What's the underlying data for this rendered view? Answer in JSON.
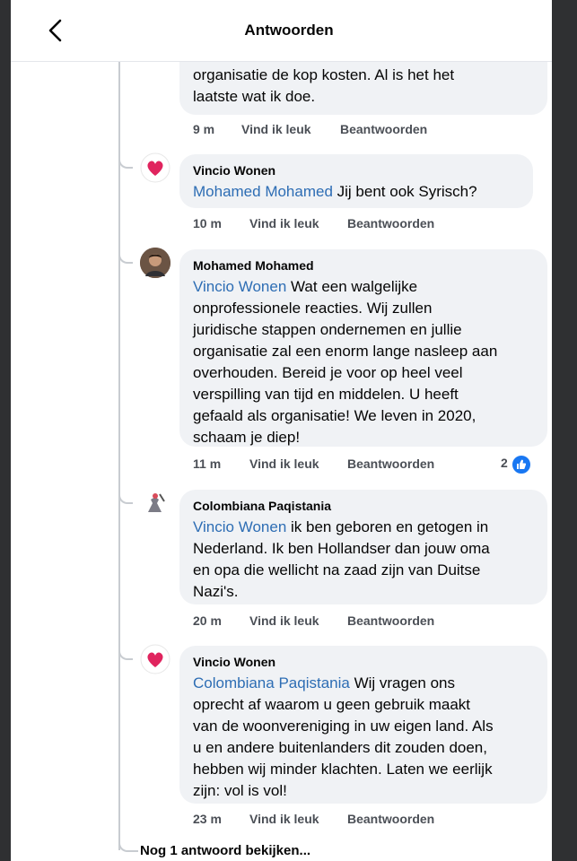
{
  "header": {
    "title": "Antwoorden",
    "back_icon": "chevron-left-icon"
  },
  "comments": [
    {
      "author": "",
      "text": "organisatie de kop kosten. Al is het het laatste wat ik doe.",
      "line1": "organisatie de kop kosten. Al is het het",
      "line2": "laatste wat ik doe.",
      "time": "9 m",
      "like": "Vind ik leuk",
      "reply": "Beantwoorden"
    },
    {
      "author": "Vincio Wonen",
      "mention": "Mohamed Mohamed",
      "text": "Jij bent ook Syrisch?",
      "time": "10 m",
      "like": "Vind ik leuk",
      "reply": "Beantwoorden"
    },
    {
      "author": "Mohamed Mohamed",
      "mention": "Vincio Wonen",
      "lines": [
        " Wat een walgelijke",
        "onprofessionele reacties. Wij zullen",
        "juridische stappen ondernemen en jullie",
        "organisatie zal een enorm lange nasleep aan",
        "overhouden. Bereid je voor op heel veel",
        "verspilling van tijd en middelen. U heeft",
        "gefaald als organisatie! We leven in 2020,",
        "schaam je diep!"
      ],
      "time": "11 m",
      "like": "Vind ik leuk",
      "reply": "Beantwoorden",
      "reaction_count": "2"
    },
    {
      "author": "Colombiana Paqistania",
      "mention": "Vincio Wonen",
      "lines": [
        " ik ben geboren en getogen in",
        "Nederland. Ik ben Hollandser dan jouw oma",
        "en opa die wellicht na zaad zijn van Duitse",
        "Nazi's."
      ],
      "time": "20 m",
      "like": "Vind ik leuk",
      "reply": "Beantwoorden"
    },
    {
      "author": "Vincio Wonen",
      "mention": "Colombiana Paqistania",
      "lines": [
        " Wij vragen ons",
        "oprecht af waarom u geen gebruik maakt",
        "van de woonvereniging in uw eigen land. Als",
        "u en andere buitenlanders dit zouden doen,",
        "hebben wij minder klachten. Laten we eerlijk",
        "zijn: vol is vol!"
      ],
      "time": "23 m",
      "like": "Vind ik leuk",
      "reply": "Beantwoorden"
    }
  ],
  "more_replies": "Nog 1 antwoord bekijken...",
  "colors": {
    "mention": "#2d6db4",
    "bubble": "#f0f2f5",
    "heart": "#e0245e",
    "like": "#1877f2"
  }
}
